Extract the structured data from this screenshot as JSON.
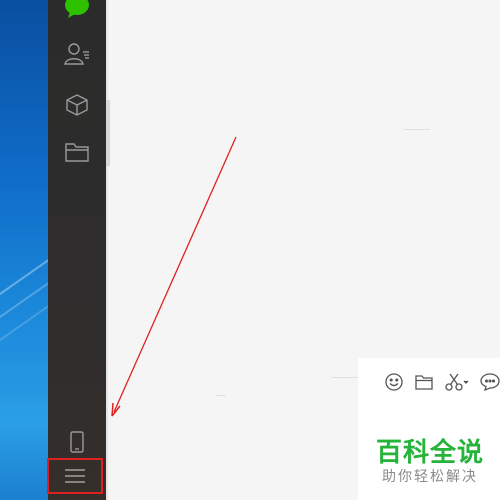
{
  "sidebar": {
    "items": [
      {
        "icon": "chat-bubble-icon",
        "color": "#2dc100"
      },
      {
        "icon": "contacts-icon"
      },
      {
        "icon": "favorites-cube-icon"
      },
      {
        "icon": "folder-icon"
      },
      {
        "icon": "phone-icon"
      },
      {
        "icon": "menu-icon"
      }
    ],
    "highlight_color": "#e02020"
  },
  "chat_toolbar": {
    "icons": [
      "emoji-icon",
      "folder-icon",
      "scissors-icon",
      "chat-history-icon"
    ]
  },
  "watermark": {
    "title": "百科全说",
    "subtitle": "助你轻松解决",
    "title_color": "#25b33a"
  },
  "annotation": {
    "arrow_color": "#e02020"
  }
}
